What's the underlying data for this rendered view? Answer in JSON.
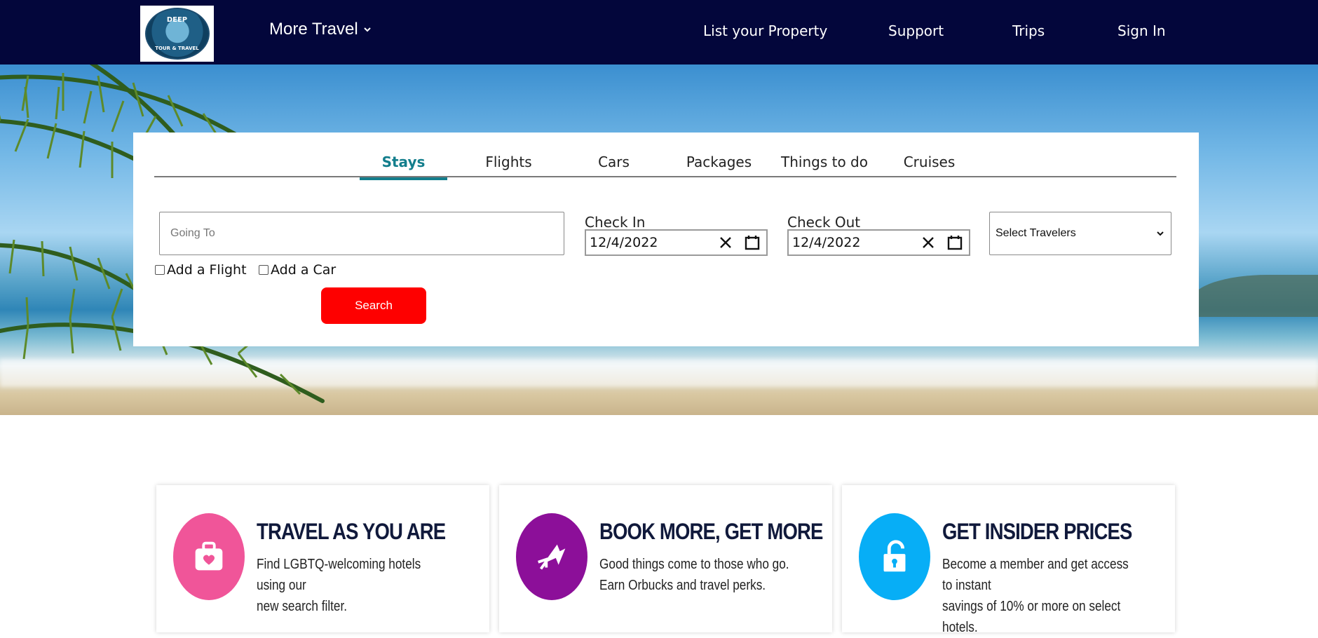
{
  "brand": {
    "logo_top": "DEEP",
    "logo_bottom": "TOUR & TRAVEL"
  },
  "nav": {
    "more_travel": "More Travel",
    "list_property": "List your Property",
    "support": "Support",
    "trips": "Trips",
    "sign_in": "Sign In"
  },
  "search": {
    "tabs": [
      {
        "label": "Stays",
        "active": true
      },
      {
        "label": "Flights"
      },
      {
        "label": "Cars"
      },
      {
        "label": "Packages"
      },
      {
        "label": "Things to do"
      },
      {
        "label": "Cruises"
      }
    ],
    "going_to_placeholder": "Going To",
    "going_to_value": "",
    "check_in_label": "Check In",
    "check_in_value": "12/4/2022",
    "check_out_label": "Check Out",
    "check_out_value": "12/4/2022",
    "travelers_selected": "Select Travelers",
    "add_flight_label": "Add a Flight",
    "add_car_label": "Add a Car",
    "search_button": "Search"
  },
  "features": [
    {
      "title": "TRAVEL AS YOU ARE",
      "line1": "Find LGBTQ-welcoming hotels using our",
      "line2": "new search filter.",
      "icon": "suitcase-heart-icon",
      "color": "#f05599"
    },
    {
      "title": "BOOK MORE, GET MORE",
      "line1": "Good things come to those who go.",
      "line2": "Earn Orbucks and travel perks.",
      "icon": "refresh-arrows-icon",
      "color": "#8c0f99"
    },
    {
      "title": "GET INSIDER PRICES",
      "line1": "Become a member and get access to instant",
      "line2": "savings of 10% or more on select hotels.",
      "icon": "unlock-icon",
      "color": "#07aef6"
    }
  ],
  "colors": {
    "navbar": "#03063b",
    "tab_active": "#137e8c",
    "search_button": "#fe0000"
  }
}
